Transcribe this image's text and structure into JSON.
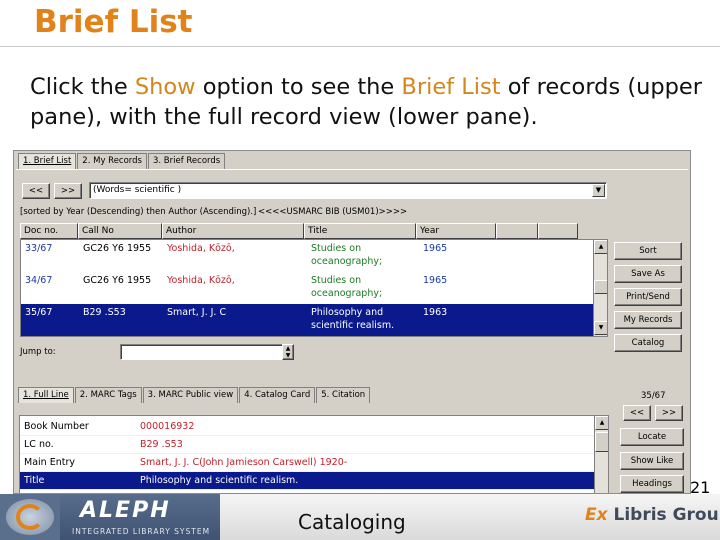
{
  "slide": {
    "title": "Brief List",
    "intro_part1": "Click the ",
    "intro_show": "Show",
    "intro_part2": " option to see the ",
    "intro_brief": "Brief List",
    "intro_part3": " of records (upper pane), with the full record view (lower pane).",
    "page_number": "21"
  },
  "upper_tabs": [
    "1. Brief List",
    "2. My Records",
    "3. Brief Records"
  ],
  "nav": {
    "prev_label": "<<",
    "next_label": ">>"
  },
  "query": {
    "value": "(Words= scientific )"
  },
  "sort_text": "[sorted by Year (Descending) then Author (Ascending).]",
  "database_text": "<<<<USMARC BIB (USM01)>>>>",
  "grid": {
    "headers": [
      "Doc no.",
      "Call No",
      "Author",
      "Title",
      "Year",
      "",
      ""
    ],
    "rows": [
      {
        "doc": "33/67",
        "call": "GC26 Y6 1955",
        "author": "Yoshida, Kōzō,",
        "title1": "Studies on",
        "title2": "oceanography;",
        "year": "1965"
      },
      {
        "doc": "34/67",
        "call": "GC26 Y6 1955",
        "author": "Yoshida, Kōzō,",
        "title1": "Studies on",
        "title2": "oceanography;",
        "year": "1965"
      },
      {
        "doc": "35/67",
        "call": "B29 .S53",
        "author": "Smart, J. J. C",
        "title1": "Philosophy and",
        "title2": "scientific realism.",
        "year": "1963"
      }
    ]
  },
  "side_buttons": [
    "Sort",
    "Save As",
    "Print/Send",
    "My Records",
    "Catalog"
  ],
  "jump": {
    "label": "Jump to:",
    "value": ""
  },
  "lower_tabs": [
    "1. Full Line",
    "2. MARC Tags",
    "3. MARC Public view",
    "4. Catalog Card",
    "5. Citation"
  ],
  "record_counter": "35/67",
  "lower_side_buttons": [
    "Locate",
    "Show Like",
    "Headings"
  ],
  "full_record": [
    {
      "label": "Book Number",
      "value": "000016932"
    },
    {
      "label": "LC no.",
      "value": "B29 .S53"
    },
    {
      "label": "Main Entry",
      "value": "Smart, J. J. C(John Jamieson Carswell) 1920-"
    },
    {
      "label": "Title",
      "value": "Philosophy and scientific realism."
    }
  ],
  "footer": {
    "product": "ALEPH",
    "product_sub": "INTEGRATED LIBRARY SYSTEM",
    "center": "Cataloging",
    "company_ex": "Ex",
    "company_rest": " Libris Group"
  },
  "colors": {
    "title_orange": "#e1821a",
    "selection_blue": "#0a1a8c",
    "panel_gray": "#d4d0c8",
    "author_red": "#c0202a",
    "title_green": "#1f7a25",
    "doc_blue": "#1a3aa0"
  }
}
